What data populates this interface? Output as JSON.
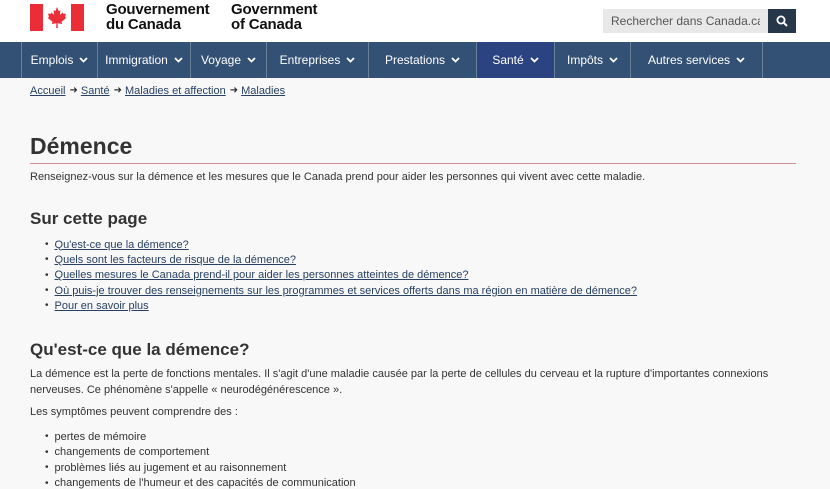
{
  "header": {
    "signature_fr": [
      "Gouvernement",
      "du Canada"
    ],
    "signature_en": [
      "Government",
      "of Canada"
    ],
    "search_placeholder": "Rechercher dans Canada.ca"
  },
  "nav": {
    "items": [
      {
        "label": "Emplois"
      },
      {
        "label": "Immigration"
      },
      {
        "label": "Voyage"
      },
      {
        "label": "Entreprises"
      },
      {
        "label": "Prestations"
      },
      {
        "label": "Santé"
      },
      {
        "label": "Impôts"
      },
      {
        "label": "Autres services"
      }
    ],
    "active": "Santé"
  },
  "breadcrumb": [
    "Accueil",
    "Santé",
    "Maladies et affection",
    "Maladies"
  ],
  "page": {
    "title": "Démence",
    "intro": "Renseignez-vous sur la démence et les mesures que le Canada prend pour aider les personnes qui vivent avec cette maladie.",
    "toc_heading": "Sur cette page",
    "toc": [
      "Qu'est-ce que la démence?",
      "Quels sont les facteurs de risque de la démence?",
      "Quelles mesures le Canada prend-il pour aider les personnes atteintes de démence?",
      "Où puis-je trouver des renseignements sur les programmes et services offerts dans ma région en matière de démence?",
      "Pour en savoir plus"
    ],
    "section1_heading": "Qu'est-ce que la démence?",
    "section1_para": "La démence est la perte de fonctions mentales. Il s'agit d'une maladie causée par la perte de cellules du cerveau et la rupture d'importantes connexions nerveuses. Ce phénomène s'appelle « neurodégénérescence ».",
    "symptoms_intro": "Les symptômes peuvent comprendre des :",
    "symptoms": [
      "pertes de mémoire",
      "changements de comportement",
      "problèmes liés au jugement et au raisonnement",
      "changements de l'humeur et des capacités de communication"
    ]
  },
  "colors": {
    "nav_bg": "#335075",
    "nav_active": "#2b4380",
    "flag_red": "#eb2d37",
    "link": "#284162"
  }
}
